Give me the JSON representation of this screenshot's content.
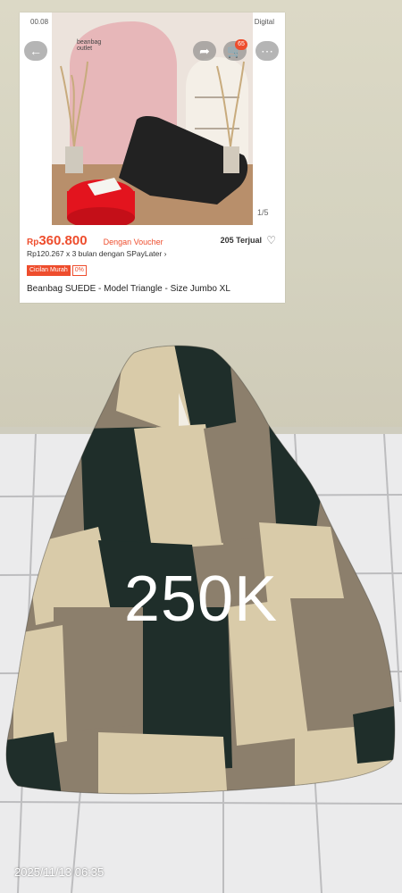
{
  "embedded_screenshot": {
    "status_time": "00.08",
    "status_right": "Digital",
    "logo_text": "beanbag outlet",
    "cart_count": "65",
    "image_counter": "1/5",
    "price_currency": "Rp",
    "price": "360.800",
    "voucher_label": "Dengan Voucher",
    "sold": "205 Terjual",
    "installment": "Rp120.267 x 3 bulan dengan SPayLater ›",
    "tag_primary": "Cicilan Murah",
    "tag_secondary": "0%",
    "product_title": "Beanbag SUEDE - Model Triangle - Size Jumbo XL"
  },
  "overlay": {
    "price_text": "250K",
    "timestamp": "2025/11/13 06:35"
  },
  "colors": {
    "accent": "#ee4d2d",
    "bag_dark": "#1f2e2a",
    "bag_tan": "#d9cba9",
    "bag_taupe": "#8c7f6c"
  },
  "icons": [
    "back-arrow-icon",
    "share-icon",
    "cart-icon",
    "more-icon",
    "heart-icon"
  ]
}
